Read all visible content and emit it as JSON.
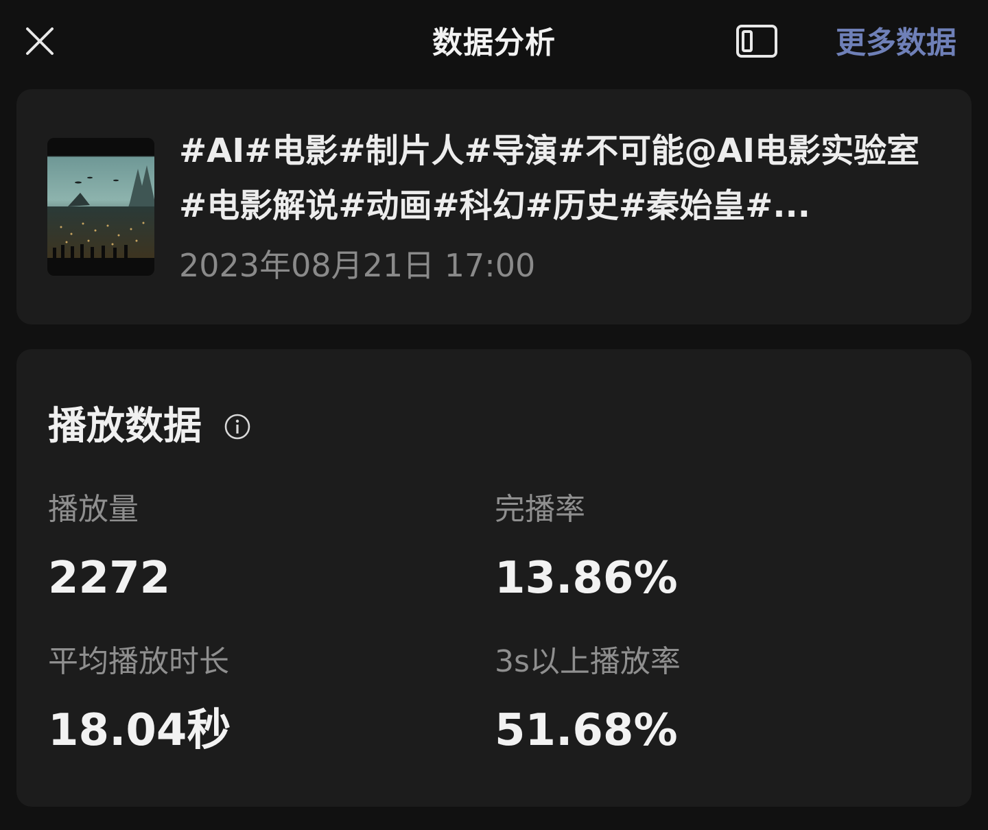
{
  "header": {
    "close_icon": "close-icon",
    "title": "数据分析",
    "layout_icon": "panel-layout-icon",
    "more_link": "更多数据"
  },
  "video": {
    "thumbnail": "video-thumbnail-sci-fi-city",
    "title": "#AI#电影#制片人#导演#不可能@AI电影实验室 #电影解说#动画#科幻#历史#秦始皇#...",
    "date": "2023年08月21日 17:00"
  },
  "playback": {
    "section_title": "播放数据",
    "info_icon": "info-icon",
    "metrics": [
      {
        "label": "播放量",
        "value": "2272"
      },
      {
        "label": "完播率",
        "value": "13.86%"
      },
      {
        "label": "平均播放时长",
        "value": "18.04秒"
      },
      {
        "label": "3s以上播放率",
        "value": "51.68%"
      }
    ]
  },
  "colors": {
    "background": "#111111",
    "card": "#1c1c1c",
    "accent_link": "#6f80b8",
    "muted_text": "#8f8f8f"
  }
}
